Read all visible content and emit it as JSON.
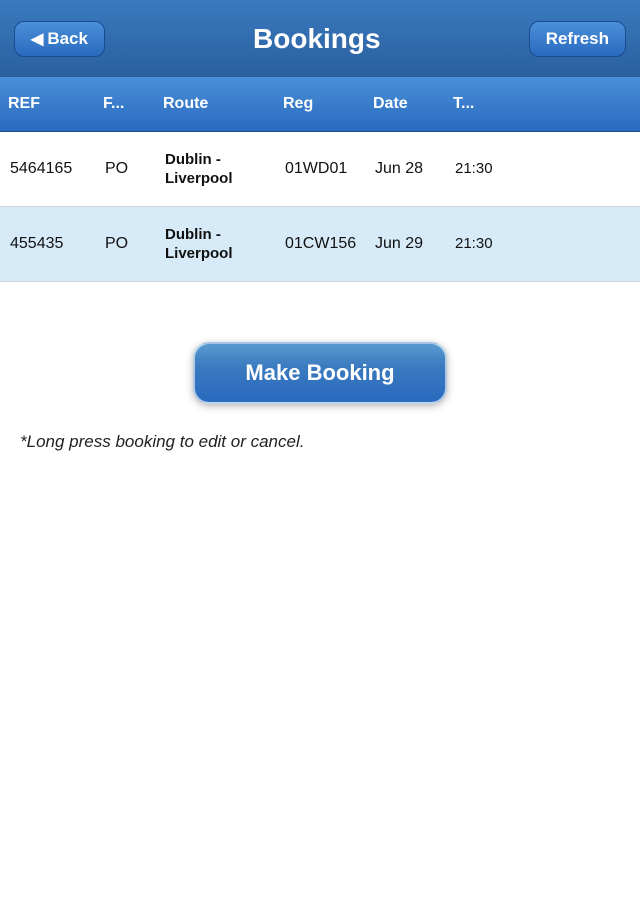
{
  "header": {
    "back_label": "Back",
    "title": "Bookings",
    "refresh_label": "Refresh"
  },
  "table": {
    "columns": [
      {
        "id": "ref",
        "label": "REF"
      },
      {
        "id": "fleet",
        "label": "F..."
      },
      {
        "id": "route",
        "label": "Route"
      },
      {
        "id": "reg",
        "label": "Reg"
      },
      {
        "id": "date",
        "label": "Date"
      },
      {
        "id": "time",
        "label": "T..."
      }
    ],
    "rows": [
      {
        "ref": "5464165",
        "fleet": "PO",
        "route": "Dublin - Liverpool",
        "reg": "01WD01",
        "date": "Jun 28",
        "time": "21:30"
      },
      {
        "ref": "455435",
        "fleet": "PO",
        "route": "Dublin - Liverpool",
        "reg": "01CW156",
        "date": "Jun 29",
        "time": "21:30"
      }
    ]
  },
  "actions": {
    "make_booking_label": "Make Booking"
  },
  "hint": {
    "text": "*Long press booking to edit or cancel."
  }
}
